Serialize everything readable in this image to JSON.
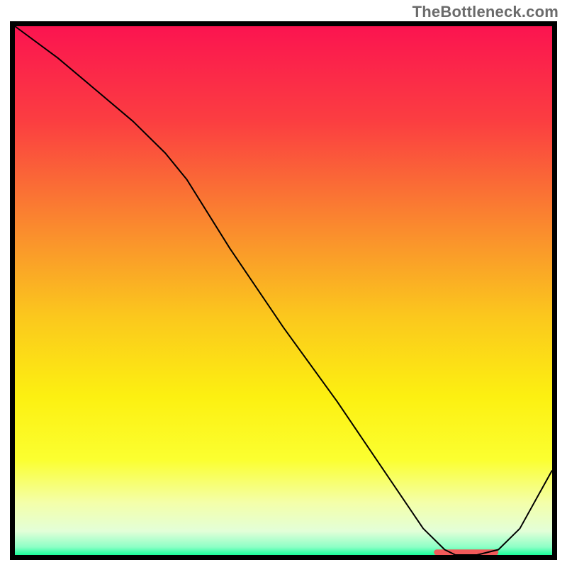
{
  "watermark": "TheBottleneck.com",
  "chart_data": {
    "type": "line",
    "title": "",
    "xlabel": "",
    "ylabel": "",
    "xlim": [
      0,
      100
    ],
    "ylim": [
      0,
      100
    ],
    "grid": false,
    "series": [
      {
        "name": "curve",
        "x": [
          0,
          8,
          15,
          22,
          28,
          32,
          40,
          50,
          60,
          70,
          76,
          80,
          82,
          86,
          90,
          94,
          100
        ],
        "values": [
          100,
          94,
          88,
          82,
          76,
          71,
          58,
          43,
          29,
          14,
          5,
          1,
          0,
          0,
          1,
          5,
          16
        ],
        "stroke": "#000000",
        "stroke_width": 2,
        "fill": "none"
      }
    ],
    "marker_band": {
      "x_start": 78,
      "x_end": 90,
      "color": "#f25a5a"
    },
    "background_gradient": {
      "stops": [
        {
          "offset": 0.0,
          "color": "#fb1450"
        },
        {
          "offset": 0.18,
          "color": "#fb3e41"
        },
        {
          "offset": 0.38,
          "color": "#fa8a2e"
        },
        {
          "offset": 0.55,
          "color": "#fbc81d"
        },
        {
          "offset": 0.7,
          "color": "#fcf011"
        },
        {
          "offset": 0.82,
          "color": "#fbff30"
        },
        {
          "offset": 0.9,
          "color": "#f4ffa8"
        },
        {
          "offset": 0.955,
          "color": "#e3ffd8"
        },
        {
          "offset": 0.985,
          "color": "#8dffc6"
        },
        {
          "offset": 1.0,
          "color": "#1aff9a"
        }
      ]
    },
    "frame": {
      "color": "#000000",
      "width": 7
    }
  }
}
